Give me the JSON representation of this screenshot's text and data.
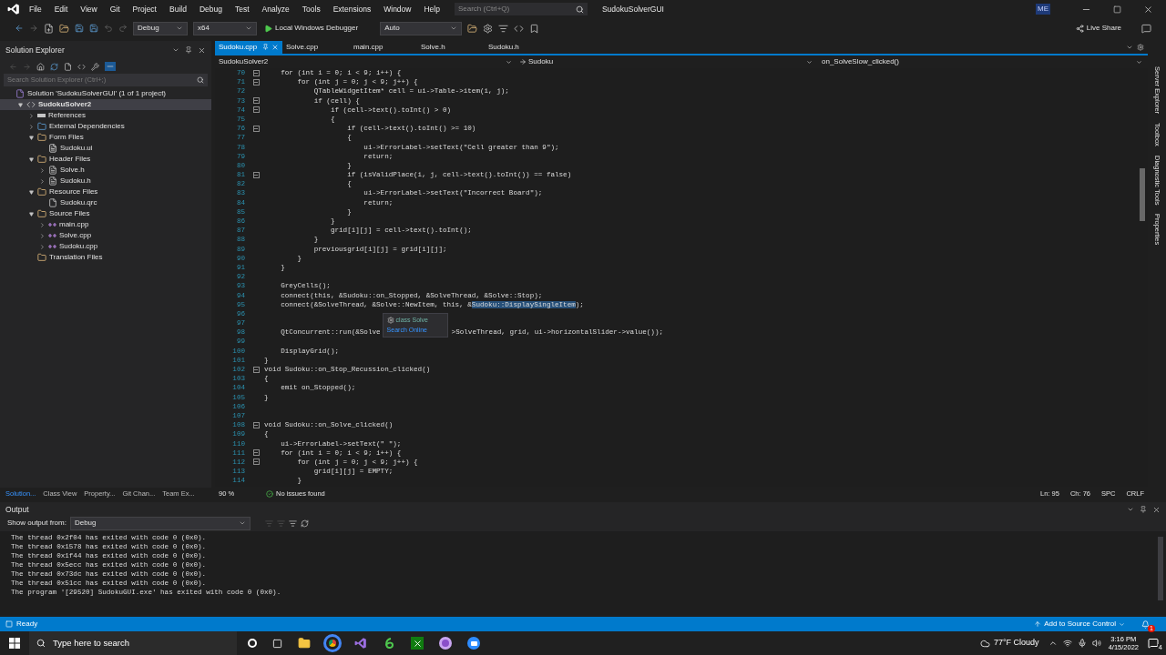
{
  "menu_bar": {
    "items": [
      "File",
      "Edit",
      "View",
      "Git",
      "Project",
      "Build",
      "Debug",
      "Test",
      "Analyze",
      "Tools",
      "Extensions",
      "Window",
      "Help"
    ],
    "search": {
      "placeholder": "Search (Ctrl+Q)"
    },
    "solution_name": "SudokuSolverGUI",
    "account_badge": "ME"
  },
  "toolbar": {
    "configuration": "Debug",
    "platform": "x64",
    "run_target": "Local Windows Debugger",
    "solution_platform": "Auto",
    "live_share": "Live Share"
  },
  "solution_explorer": {
    "title": "Solution Explorer",
    "search": {
      "placeholder": "Search Solution Explorer (Ctrl+;)"
    },
    "tree": [
      {
        "label": "Solution 'SudokuSolverGUI' (1 of 1 project)",
        "kind": "solution",
        "selected": false,
        "children": [
          {
            "label": "SudokuSolver2",
            "kind": "project",
            "selected": true,
            "expanded": true,
            "children": [
              {
                "label": "References",
                "kind": "references",
                "selected": false,
                "expanded": false
              },
              {
                "label": "External Dependencies",
                "kind": "dependencies",
                "selected": false,
                "expanded": false
              },
              {
                "label": "Form Files",
                "kind": "folder",
                "selected": false,
                "expanded": true,
                "children": [
                  {
                    "label": "Sudoku.ui",
                    "kind": "ui",
                    "selected": false
                  }
                ]
              },
              {
                "label": "Header Files",
                "kind": "folder",
                "selected": false,
                "expanded": true,
                "children": [
                  {
                    "label": "Solve.h",
                    "kind": "header",
                    "selected": false,
                    "expanded": false
                  },
                  {
                    "label": "Sudoku.h",
                    "kind": "header",
                    "selected": false,
                    "expanded": false
                  }
                ]
              },
              {
                "label": "Resource Files",
                "kind": "folder",
                "selected": false,
                "expanded": true,
                "children": [
                  {
                    "label": "Sudoku.qrc",
                    "kind": "resource",
                    "selected": false
                  }
                ]
              },
              {
                "label": "Source Files",
                "kind": "folder",
                "selected": false,
                "expanded": true,
                "children": [
                  {
                    "label": "main.cpp",
                    "kind": "source",
                    "selected": false,
                    "expanded": false
                  },
                  {
                    "label": "Solve.cpp",
                    "kind": "source",
                    "selected": false,
                    "expanded": false
                  },
                  {
                    "label": "Sudoku.cpp",
                    "kind": "source",
                    "selected": false,
                    "expanded": false
                  }
                ]
              },
              {
                "label": "Translation Files",
                "kind": "folder",
                "selected": false
              }
            ]
          }
        ]
      }
    ],
    "bottom_tabs": [
      {
        "label": "Solution...",
        "selected": true
      },
      {
        "label": "Class View",
        "selected": false
      },
      {
        "label": "Property...",
        "selected": false
      },
      {
        "label": "Git Chan...",
        "selected": false
      },
      {
        "label": "Team Ex...",
        "selected": false
      }
    ]
  },
  "editor": {
    "tabs": [
      {
        "label": "Sudoku.cpp",
        "selected": true
      },
      {
        "label": "Solve.cpp",
        "selected": false
      },
      {
        "label": "main.cpp",
        "selected": false
      },
      {
        "label": "Solve.h",
        "selected": false
      },
      {
        "label": "Sudoku.h",
        "selected": false
      }
    ],
    "breadcrumb": {
      "project": "SudokuSolver2",
      "scope": "Sudoku",
      "member": "on_SolveSlow_clicked()"
    },
    "lines": [
      {
        "number": "70",
        "fold": true,
        "code": "    for (int i = 0; i < 9; i++) {"
      },
      {
        "number": "71",
        "fold": true,
        "code": "        for (int j = 0; j < 9; j++) {"
      },
      {
        "number": "72",
        "fold": false,
        "code": "            QTableWidgetItem* cell = ui->Table->item(i, j);"
      },
      {
        "number": "73",
        "fold": true,
        "code": "            if (cell) {"
      },
      {
        "number": "74",
        "fold": true,
        "code": "                if (cell->text().toInt() > 0)"
      },
      {
        "number": "75",
        "fold": false,
        "code": "                {"
      },
      {
        "number": "76",
        "fold": true,
        "code": "                    if (cell->text().toInt() >= 10)"
      },
      {
        "number": "77",
        "fold": false,
        "code": "                    {"
      },
      {
        "number": "78",
        "fold": false,
        "code": "                        ui->ErrorLabel->setText(\"Cell greater than 9\");"
      },
      {
        "number": "79",
        "fold": false,
        "code": "                        return;"
      },
      {
        "number": "80",
        "fold": false,
        "code": "                    }"
      },
      {
        "number": "81",
        "fold": true,
        "code": "                    if (isValidPlace(i, j, cell->text().toInt()) == false)"
      },
      {
        "number": "82",
        "fold": false,
        "code": "                    {"
      },
      {
        "number": "83",
        "fold": false,
        "code": "                        ui->ErrorLabel->setText(\"Incorrect Board\");"
      },
      {
        "number": "84",
        "fold": false,
        "code": "                        return;"
      },
      {
        "number": "85",
        "fold": false,
        "code": "                    }"
      },
      {
        "number": "86",
        "fold": false,
        "code": "                }"
      },
      {
        "number": "87",
        "fold": false,
        "code": "                grid[i][j] = cell->text().toInt();"
      },
      {
        "number": "88",
        "fold": false,
        "code": "            }"
      },
      {
        "number": "89",
        "fold": false,
        "code": "            previousgrid[i][j] = grid[i][j];"
      },
      {
        "number": "90",
        "fold": false,
        "code": "        }"
      },
      {
        "number": "91",
        "fold": false,
        "code": "    }"
      },
      {
        "number": "92",
        "fold": false
      },
      {
        "number": "93",
        "fold": false,
        "code": "    GreyCells();"
      },
      {
        "number": "94",
        "fold": false,
        "code": "    connect(this, &Sudoku::on_Stopped, &SolveThread, &Solve::Stop);"
      },
      {
        "number": "95",
        "fold": false,
        "segments": [
          {
            "text": "    connect(&SolveThread, &Solve::NewItem, this, &",
            "selected": false
          },
          {
            "text": "Sudoku::DisplaySingleItem",
            "selected": true
          },
          {
            "text": ");",
            "selected": false
          }
        ]
      },
      {
        "number": "96",
        "fold": false
      },
      {
        "number": "97",
        "fold": false
      },
      {
        "number": "98",
        "fold": false,
        "code": "    QtConcurrent::run(&Solve",
        "code_after_popup": ">SolveThread, grid, ui->horizontalSlider->value());"
      },
      {
        "number": "99",
        "fold": false
      },
      {
        "number": "100",
        "fold": false,
        "code": "    DisplayGrid();"
      },
      {
        "number": "101",
        "fold": false,
        "code": "}"
      },
      {
        "number": "102",
        "fold": true,
        "code": "void Sudoku::on_Stop_Recussion_clicked()"
      },
      {
        "number": "103",
        "fold": false,
        "code": "{"
      },
      {
        "number": "104",
        "fold": false,
        "code": "    emit on_Stopped();"
      },
      {
        "number": "105",
        "fold": false,
        "code": "}"
      },
      {
        "number": "106",
        "fold": false
      },
      {
        "number": "107",
        "fold": false
      },
      {
        "number": "108",
        "fold": true,
        "code": "void Sudoku::on_Solve_clicked()"
      },
      {
        "number": "109",
        "fold": false,
        "code": "{"
      },
      {
        "number": "110",
        "fold": false,
        "code": "    ui->ErrorLabel->setText(\" \");"
      },
      {
        "number": "111",
        "fold": true,
        "code": "    for (int i = 0; i < 9; i++) {"
      },
      {
        "number": "112",
        "fold": true,
        "code": "        for (int j = 0; j < 9; j++) {"
      },
      {
        "number": "113",
        "fold": false,
        "code": "            grid[i][j] = EMPTY;"
      },
      {
        "number": "114",
        "fold": false,
        "code": "        }"
      }
    ],
    "popup": {
      "items": [
        "class Solve",
        "Search Online"
      ]
    },
    "status": {
      "zoom": "90 %",
      "issues": "No issues found",
      "line": "Ln: 95",
      "column": "Ch: 76",
      "whitespace": "SPC",
      "line_endings": "CRLF"
    }
  },
  "side_strip": [
    "Server Explorer",
    "Toolbox",
    "Diagnostic Tools",
    "Properties"
  ],
  "output": {
    "title": "Output",
    "show_from_label": "Show output from:",
    "source": "Debug",
    "lines": [
      "The thread 0x2f04 has exited with code 0 (0x0).",
      "The thread 0x1578 has exited with code 0 (0x0).",
      "The thread 0x1f44 has exited with code 0 (0x0).",
      "The thread 0x5ecc has exited with code 0 (0x0).",
      "The thread 0x73dc has exited with code 0 (0x0).",
      "The thread 0x51cc has exited with code 0 (0x0).",
      "The program '[29520] SudokuGUI.exe' has exited with code 0 (0x0)."
    ]
  },
  "status_bar": {
    "state": "Ready",
    "source_control": "Add to Source Control",
    "notifications": "1"
  },
  "taskbar": {
    "search": {
      "placeholder": "Type here to search"
    },
    "weather": "77°F Cloudy",
    "time": "3:16 PM",
    "date": "4/15/2022",
    "notifications": "4"
  }
}
